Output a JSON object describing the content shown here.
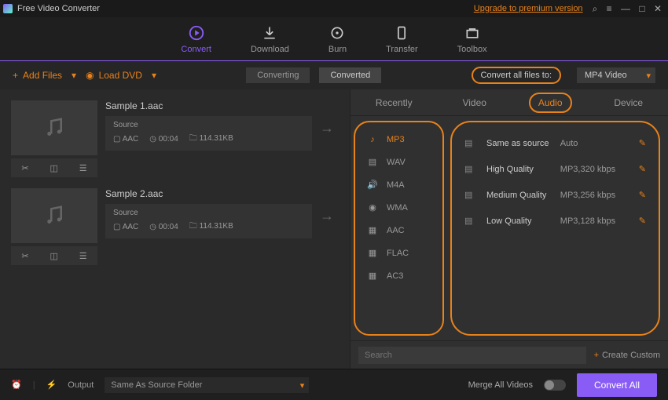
{
  "titlebar": {
    "title": "Free Video Converter",
    "upgrade": "Upgrade to premium version"
  },
  "nav": {
    "convert": "Convert",
    "download": "Download",
    "burn": "Burn",
    "transfer": "Transfer",
    "toolbox": "Toolbox"
  },
  "toolbar": {
    "addFiles": "Add Files",
    "loadDvd": "Load DVD",
    "converting": "Converting",
    "converted": "Converted",
    "convertAllLabel": "Convert all files to:",
    "formatSelected": "MP4 Video"
  },
  "files": [
    {
      "name": "Sample 1.aac",
      "sourceLabel": "Source",
      "codec": "AAC",
      "duration": "00:04",
      "size": "114.31KB"
    },
    {
      "name": "Sample 2.aac",
      "sourceLabel": "Source",
      "codec": "AAC",
      "duration": "00:04",
      "size": "114.31KB"
    }
  ],
  "panelTabs": {
    "recently": "Recently",
    "video": "Video",
    "audio": "Audio",
    "device": "Device"
  },
  "formats": [
    {
      "label": "MP3"
    },
    {
      "label": "WAV"
    },
    {
      "label": "M4A"
    },
    {
      "label": "WMA"
    },
    {
      "label": "AAC"
    },
    {
      "label": "FLAC"
    },
    {
      "label": "AC3"
    }
  ],
  "qualities": [
    {
      "name": "Same as source",
      "spec": "Auto"
    },
    {
      "name": "High Quality",
      "spec": "MP3,320 kbps"
    },
    {
      "name": "Medium Quality",
      "spec": "MP3,256 kbps"
    },
    {
      "name": "Low Quality",
      "spec": "MP3,128 kbps"
    }
  ],
  "panelFoot": {
    "searchPlaceholder": "Search",
    "createCustom": "Create Custom"
  },
  "bottom": {
    "outputLabel": "Output",
    "outputPath": "Same As Source Folder",
    "mergeLabel": "Merge All Videos",
    "convertBtn": "Convert All"
  }
}
